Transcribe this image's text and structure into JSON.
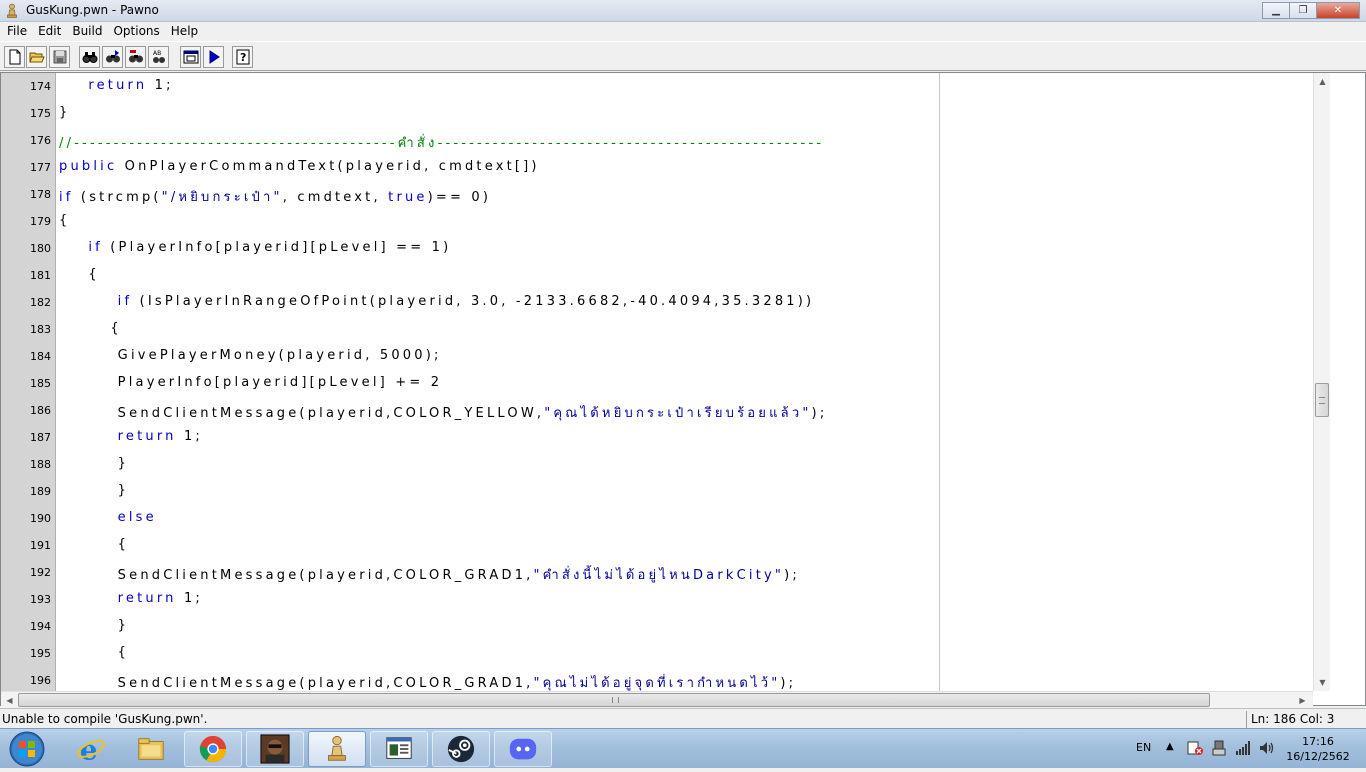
{
  "window": {
    "title": "GusKung.pwn - Pawno"
  },
  "menu": {
    "items": [
      "File",
      "Edit",
      "Build",
      "Options",
      "Help"
    ]
  },
  "toolbar": {
    "buttons": [
      "new-file-icon",
      "open-file-icon",
      "save-file-icon",
      "find-icon",
      "find-next-icon",
      "replace-icon",
      "goto-icon",
      "font-icon",
      "compile-run-icon",
      "help-icon"
    ]
  },
  "editor": {
    "lines": [
      {
        "num": "174",
        "indent": "    ",
        "segments": [
          {
            "t": "return",
            "c": "kw"
          },
          {
            "t": " 1;",
            "c": ""
          }
        ]
      },
      {
        "num": "175",
        "indent": "",
        "segments": [
          {
            "t": "}",
            "c": ""
          }
        ]
      },
      {
        "num": "176",
        "indent": "",
        "segments": [
          {
            "t": "//-----------------------------------------คำสั่ง-------------------------------------------------",
            "c": "cmt"
          }
        ]
      },
      {
        "num": "177",
        "indent": "",
        "segments": [
          {
            "t": "public",
            "c": "kw"
          },
          {
            "t": " OnPlayerCommandText(playerid, cmdtext[])",
            "c": ""
          }
        ]
      },
      {
        "num": "178",
        "indent": "",
        "segments": [
          {
            "t": "if",
            "c": "kw"
          },
          {
            "t": " (strcmp(",
            "c": ""
          },
          {
            "t": "\"/หยิบกระเป๋า\"",
            "c": "str"
          },
          {
            "t": ", cmdtext, ",
            "c": ""
          },
          {
            "t": "true",
            "c": "kw"
          },
          {
            "t": ")== 0)",
            "c": ""
          }
        ]
      },
      {
        "num": "179",
        "indent": "",
        "segments": [
          {
            "t": "{",
            "c": ""
          }
        ]
      },
      {
        "num": "180",
        "indent": "    ",
        "segments": [
          {
            "t": "if",
            "c": "kw"
          },
          {
            "t": " (PlayerInfo[playerid][pLevel] == 1)",
            "c": ""
          }
        ]
      },
      {
        "num": "181",
        "indent": "    ",
        "segments": [
          {
            "t": "{",
            "c": ""
          }
        ]
      },
      {
        "num": "182",
        "indent": "        ",
        "segments": [
          {
            "t": "if",
            "c": "kw"
          },
          {
            "t": " (IsPlayerInRangeOfPoint(playerid, 3.0, -2133.6682,-40.4094,35.3281))",
            "c": ""
          }
        ]
      },
      {
        "num": "183",
        "indent": "       ",
        "segments": [
          {
            "t": "{",
            "c": ""
          }
        ]
      },
      {
        "num": "184",
        "indent": "        ",
        "segments": [
          {
            "t": "GivePlayerMoney(playerid, 5000);",
            "c": ""
          }
        ]
      },
      {
        "num": "185",
        "indent": "        ",
        "segments": [
          {
            "t": "PlayerInfo[playerid][pLevel] += 2",
            "c": ""
          }
        ]
      },
      {
        "num": "186",
        "indent": "        ",
        "segments": [
          {
            "t": "SendClientMessage(playerid,COLOR_YELLOW,",
            "c": ""
          },
          {
            "t": "\"คุณได้หยิบกระเป๋าเรียบร้อยแล้ว\"",
            "c": "str"
          },
          {
            "t": ");",
            "c": ""
          }
        ]
      },
      {
        "num": "187",
        "indent": "        ",
        "segments": [
          {
            "t": "return",
            "c": "kw"
          },
          {
            "t": " 1;",
            "c": ""
          }
        ]
      },
      {
        "num": "188",
        "indent": "        ",
        "segments": [
          {
            "t": "}",
            "c": ""
          }
        ]
      },
      {
        "num": "189",
        "indent": "        ",
        "segments": [
          {
            "t": "}",
            "c": ""
          }
        ]
      },
      {
        "num": "190",
        "indent": "        ",
        "segments": [
          {
            "t": "else",
            "c": "kw"
          }
        ]
      },
      {
        "num": "191",
        "indent": "        ",
        "segments": [
          {
            "t": "{",
            "c": ""
          }
        ]
      },
      {
        "num": "192",
        "indent": "        ",
        "segments": [
          {
            "t": "SendClientMessage(playerid,COLOR_GRAD1,",
            "c": ""
          },
          {
            "t": "\"คำสั่งนี้ไม่ได้อยู่ไหนDarkCity\"",
            "c": "str"
          },
          {
            "t": ");",
            "c": ""
          }
        ]
      },
      {
        "num": "193",
        "indent": "        ",
        "segments": [
          {
            "t": "return",
            "c": "kw"
          },
          {
            "t": " 1;",
            "c": ""
          }
        ]
      },
      {
        "num": "194",
        "indent": "        ",
        "segments": [
          {
            "t": "}",
            "c": ""
          }
        ]
      },
      {
        "num": "195",
        "indent": "        ",
        "segments": [
          {
            "t": "{",
            "c": ""
          }
        ]
      },
      {
        "num": "196",
        "indent": "        ",
        "segments": [
          {
            "t": "SendClientMessage(playerid,COLOR_GRAD1,",
            "c": ""
          },
          {
            "t": "\"คุณไม่ได้อยู่จุดที่เรากำหนดไว้\"",
            "c": "str"
          },
          {
            "t": ");",
            "c": ""
          }
        ]
      }
    ]
  },
  "status": {
    "message": "Unable to compile 'GusKung.pwn'.",
    "position": "Ln: 186   Col: 3"
  },
  "taskbar": {
    "items": [
      "internet-explorer-icon",
      "file-explorer-icon",
      "chrome-icon",
      "gta-sa-icon",
      "pawno-icon",
      "document-viewer-icon",
      "steam-icon",
      "discord-icon"
    ],
    "language": "EN",
    "time": "17:16",
    "date": "16/12/2562"
  }
}
